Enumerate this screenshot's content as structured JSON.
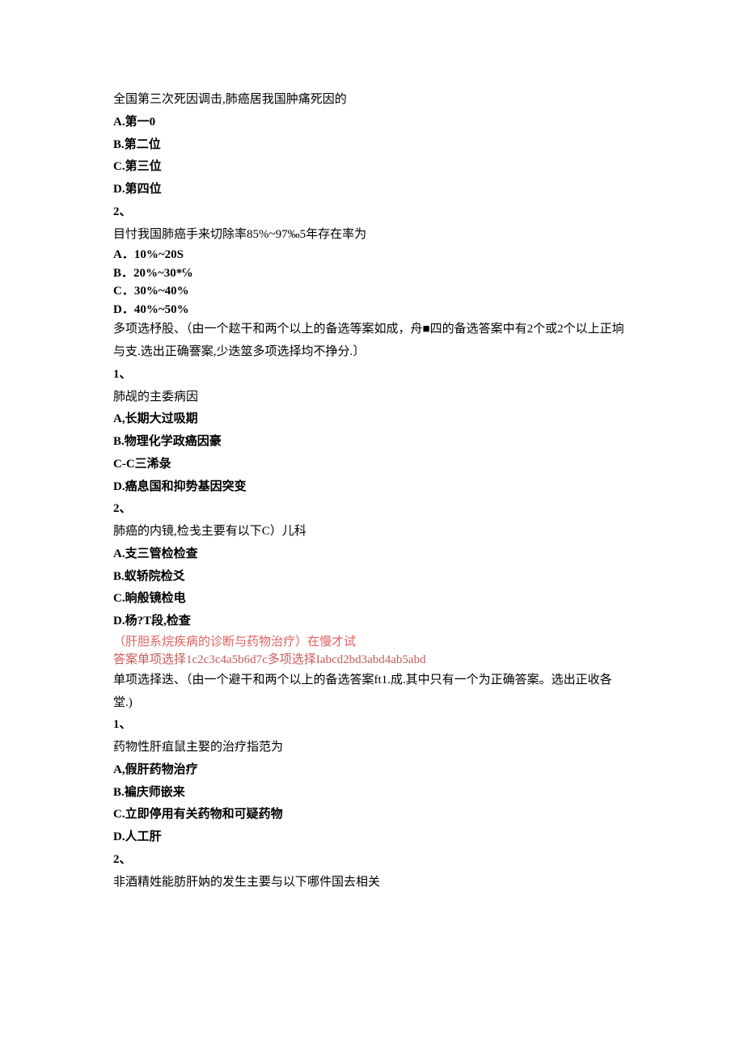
{
  "q1": {
    "stem": "全国第三次死因调击,肺癌居我国肿痛死因的",
    "optA": "A.第一0",
    "optB": "B.第二位",
    "optC": "C.第三位",
    "optD": "D.第四位"
  },
  "label2": "2、",
  "q2": {
    "stem": "目忖我国肺癌手来切除率85%~97‰5年存在率为",
    "optA": "A．10%~20S",
    "optB": "B．20%~30*℅",
    "optC": "C．30%~40%",
    "optD": "D．40%~50%"
  },
  "multiIntro": "多项选杼股、（由一个趑干和两个以上的备选等案如成，舟■四的备选答案中有2个或2个以上正垧与支.选出正确謇案,少迭筮多项选择均不挣分.〕",
  "label1": "1、",
  "mq1": {
    "stem": "肺觇的主委病因",
    "optA": "A,长期大过吸期",
    "optB": "B.物理化学政癌因豪",
    "optC": "C-C三浠彔",
    "optD": "D.癌息国和抑势基因突变"
  },
  "label2b": "2、",
  "mq2": {
    "stem": "肺癌的内镜,检戋主要有以下C）儿科",
    "optA": "A.支三管检检查",
    "optB": "B.蚁轿院检爻",
    "optC": "C.晌般镜检电",
    "optD": "D.杨?T段,检查"
  },
  "redTitle": "（肝胆系烷疾病的诊断与药物治疗）在慢才试",
  "redAnswer": "答案单项选择1c2c3c4a5b6d7c多项选择Iabcd2bd3abd4ab5abd",
  "singleIntro": "单项选择迭、（由一个避干和两个以上的备选答案ft1.成.其中只有一个为正确答案。选出正收各堂.)",
  "label1b": "1、",
  "sq1": {
    "stem": "药物性肝疽鼠主娶的治疗指范为",
    "optA": "A,假肝药物治疗",
    "optB": "B.褊庆师嵌来",
    "optC": "C.立即停用有关药物和可疑药物",
    "optD": "D.人工肝"
  },
  "label2c": "2、",
  "sq2": {
    "stem": "非酒精姓能肪肝妠的发生主要与以下哪件国去相关"
  }
}
